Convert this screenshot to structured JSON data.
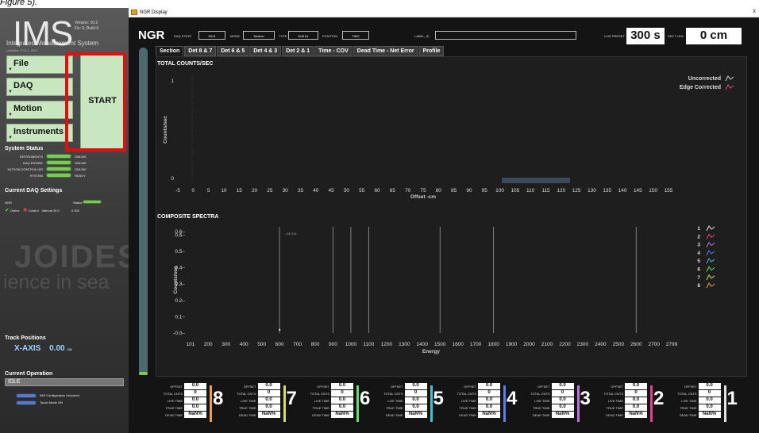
{
  "caption": "Figure 5).",
  "sidebar": {
    "logo": "IMS",
    "version": "Version: 10.2",
    "build": "Fix: 0, Build 0",
    "subtitle": "Integrated Measurement System",
    "labview": "LabView: 17.0.1, 2017",
    "menu": [
      "File",
      "DAQ",
      "Motion",
      "Instruments"
    ],
    "start_label": "START",
    "system_status_title": "System Status",
    "status_rows": [
      {
        "label": "INSTRUMENTS",
        "value": "ONLINE"
      },
      {
        "label": "DAQ ENGINE",
        "value": "ONLINE"
      },
      {
        "label": "MOTION CONTROLLER",
        "value": "ONLINE"
      },
      {
        "label": "SYSTEM",
        "value": "READY"
      }
    ],
    "daq_title": "Current DAQ Settings",
    "daq_instrument": "NGR",
    "daq_status_label": "Status",
    "daq_online": "Online",
    "daq_control": "Control",
    "daq_interval": "Interval 10.0",
    "daq_count": "# 300",
    "watermark_1": "JOIDES",
    "watermark_2": "ience in sea",
    "track_title": "Track Positions",
    "axis_label": "X-AXIS",
    "axis_value": "0.00",
    "axis_unit": "CM",
    "current_op_title": "Current Operation",
    "current_op": "IDLE",
    "config_unlocked": "IMS Configuration Unlocked",
    "touch_mode": "Touch Mode ON"
  },
  "window": {
    "title": "NGR Display",
    "close": "X"
  },
  "header": {
    "instrument": "NGR",
    "daq_state_label": "DAQ STATE",
    "daq_state": "IDLE",
    "mode_label": "MODE",
    "mode": "Section",
    "type_label": "TYPE",
    "type": "Drift #1",
    "position_label": "POSITION",
    "position": "TWO",
    "label_id_label": "LABEL_ID",
    "label_id": "",
    "live_preset_label": "LIVE PRESET",
    "live_preset": "300 s",
    "sect_len_label": "SECT LEN",
    "sect_len": "0 cm"
  },
  "tabs": [
    "Section",
    "Det 8 & 7",
    "Det 6 & 5",
    "Det 4 & 3",
    "Det 2 & 1",
    "Time - COV",
    "Dead Time - Net Error",
    "Profile"
  ],
  "chart_data": [
    {
      "type": "line",
      "title": "TOTAL COUNTS/SEC",
      "xlabel": "Offset -cm",
      "ylabel": "Counts/sec",
      "x_ticks": [
        "-5",
        "0",
        "5",
        "10",
        "15",
        "20",
        "25",
        "30",
        "35",
        "40",
        "45",
        "50",
        "55",
        "60",
        "65",
        "70",
        "75",
        "80",
        "85",
        "90",
        "95",
        "100",
        "105",
        "110",
        "115",
        "120",
        "125",
        "130",
        "135",
        "140",
        "145",
        "150",
        "155"
      ],
      "y_ticks": [
        "0",
        "1"
      ],
      "xlim": [
        -5,
        155
      ],
      "ylim": [
        0,
        1
      ],
      "legend": [
        "Uncorrected",
        "Edge Corrected"
      ],
      "legend_colors": [
        "#cfcfcf",
        "#e8408a"
      ],
      "legend_placement": "top-right",
      "series": []
    },
    {
      "type": "line",
      "title": "COMPOSITE SPECTRA",
      "xlabel": "Energy",
      "ylabel": "Counts/sec",
      "x_ticks": [
        "101",
        "200",
        "300",
        "400",
        "500",
        "600",
        "700",
        "800",
        "900",
        "1000",
        "1100",
        "1200",
        "1300",
        "1400",
        "1500",
        "1600",
        "1700",
        "1800",
        "1900",
        "2000",
        "2100",
        "2200",
        "2300",
        "2400",
        "2500",
        "2600",
        "2700",
        "2799"
      ],
      "y_ticks": [
        "-0.0",
        "0.1",
        "0.2",
        "0.3",
        "0.4",
        "0.5",
        "0.6",
        "0.6"
      ],
      "xlim": [
        101,
        2799
      ],
      "ylim": [
        0,
        0.65
      ],
      "legend": [
        "1",
        "2",
        "3",
        "4",
        "5",
        "6",
        "7",
        "8"
      ],
      "legend_colors": [
        "#e0e0e0",
        "#e8408a",
        "#c070e0",
        "#5a80f0",
        "#40c0d0",
        "#60e070",
        "#d0e050",
        "#f0a040"
      ],
      "legend_placement": "right",
      "marker_label": "– 65 214",
      "peak_lines_energy": [
        600,
        900,
        1000,
        1100,
        1500,
        1800,
        2600
      ],
      "series": []
    }
  ],
  "detectors": [
    {
      "num": "8",
      "offset": "0.0",
      "total": "0",
      "live": "0.0",
      "true": "0.0",
      "dead": "NaN%",
      "color": "#f0a040"
    },
    {
      "num": "7",
      "offset": "0.0",
      "total": "0",
      "live": "0.0",
      "true": "0.0",
      "dead": "NaN%",
      "color": "#d0e050"
    },
    {
      "num": "6",
      "offset": "0.0",
      "total": "0",
      "live": "0.0",
      "true": "0.0",
      "dead": "NaN%",
      "color": "#60e070"
    },
    {
      "num": "5",
      "offset": "0.0",
      "total": "0",
      "live": "0.0",
      "true": "0.0",
      "dead": "NaN%",
      "color": "#40c0d0"
    },
    {
      "num": "4",
      "offset": "0.0",
      "total": "0",
      "live": "0.0",
      "true": "0.0",
      "dead": "NaN%",
      "color": "#5a80f0"
    },
    {
      "num": "3",
      "offset": "0.0",
      "total": "0",
      "live": "0.0",
      "true": "0.0",
      "dead": "NaN%",
      "color": "#c070e0"
    },
    {
      "num": "2",
      "offset": "0.0",
      "total": "0",
      "live": "0.0",
      "true": "0.0",
      "dead": "NaN%",
      "color": "#e8408a"
    },
    {
      "num": "1",
      "offset": "0.0",
      "total": "0",
      "live": "0.0",
      "true": "0.0",
      "dead": "NaN%",
      "color": "#e0e0e0"
    }
  ],
  "detector_labels": {
    "offset": "OFFSET",
    "total": "TOTAL CNTS",
    "live": "LIVE TIME",
    "true": "TRUE TIME",
    "dead": "DEAD TIME"
  }
}
